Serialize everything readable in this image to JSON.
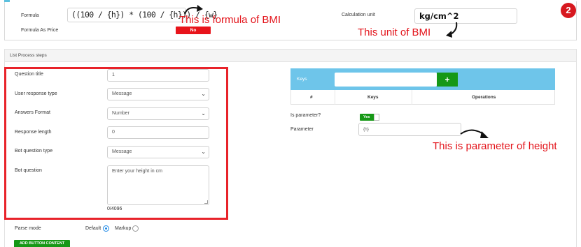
{
  "top": {
    "formula_label": "Formula",
    "formula_value": "((100 / {h}) * (100 / {h})) / {w}",
    "formula_as_price_label": "Formula As Price",
    "formula_as_price_value": "No",
    "calc_unit_label": "Calculation unit",
    "calc_unit_value": "kg/cm^2",
    "step_badge": "2"
  },
  "annotations": {
    "formula_note": "This is formula of BMI",
    "unit_note": "This unit of BMI",
    "parameter_note": "This is parameter of height"
  },
  "steps": {
    "title": "List Process steps",
    "question_title_label": "Question title",
    "question_title_value": "1",
    "user_response_type_label": "User response type",
    "user_response_type_value": "Message",
    "answers_format_label": "Answers Format",
    "answers_format_value": "Number",
    "response_length_label": "Response length",
    "response_length_value": "0",
    "bot_question_type_label": "Bot question type",
    "bot_question_type_value": "Message",
    "bot_question_label": "Bot question",
    "bot_question_value": "Enter your height in cm",
    "char_counter": "0/4096",
    "parse_mode_label": "Parse mode",
    "parse_default_label": "Default",
    "parse_markup_label": "Markup",
    "parse_selected": "Default",
    "add_button_label": "ADD BUTTON CONTENT"
  },
  "keys": {
    "label": "Keys",
    "add_label": "+",
    "columns": [
      "#",
      "Keys",
      "Operations"
    ],
    "is_parameter_label": "Is parameter?",
    "is_parameter_value": "Yes",
    "parameter_label": "Parameter",
    "parameter_value": "{h}"
  },
  "colors": {
    "accent_red": "#e3141b",
    "accent_green": "#169816",
    "keys_bar_blue": "#6ec5ea",
    "badge_red": "#d71920"
  },
  "icons": [
    "plus-icon",
    "chevron-down-icon",
    "curved-arrow-icon"
  ]
}
